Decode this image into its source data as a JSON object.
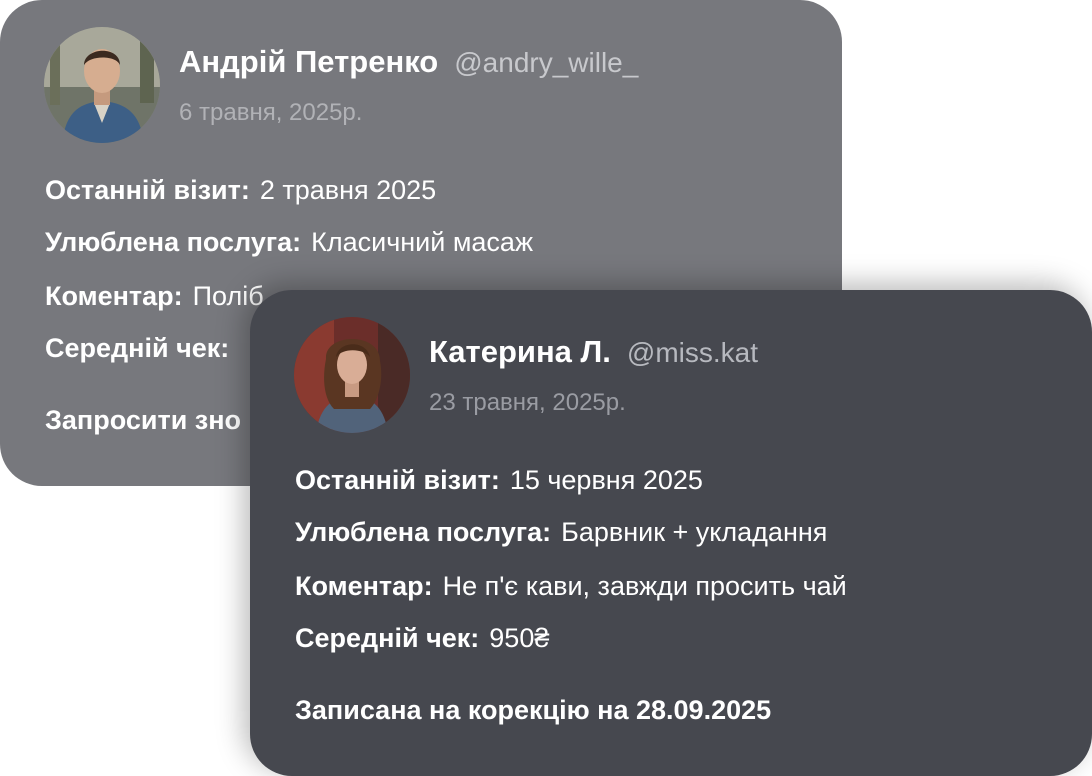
{
  "cards": [
    {
      "name": "Андрій Петренко",
      "handle": "@andry_wille_",
      "date": "6 травня, 2025р.",
      "fields": [
        {
          "label": "Останній візит:",
          "value": "2 травня 2025"
        },
        {
          "label": "Улюблена послуга:",
          "value": "Класичний масаж"
        },
        {
          "label": "Коментар:",
          "value": "Поліб"
        },
        {
          "label": "Середній чек:",
          "value": ""
        }
      ],
      "footer": "Запросити зно"
    },
    {
      "name": "Катерина Л.",
      "handle": "@miss.kat",
      "date": "23 травня, 2025р.",
      "fields": [
        {
          "label": "Останній візит:",
          "value": "15 червня 2025"
        },
        {
          "label": "Улюблена послуга:",
          "value": "Барвник + укладання"
        },
        {
          "label": "Коментар:",
          "value": "Не п'є кави, завжди просить чай"
        },
        {
          "label": "Середній чек:",
          "value": "950₴"
        }
      ],
      "footer": "Записана на корекцію на 28.09.2025"
    }
  ]
}
